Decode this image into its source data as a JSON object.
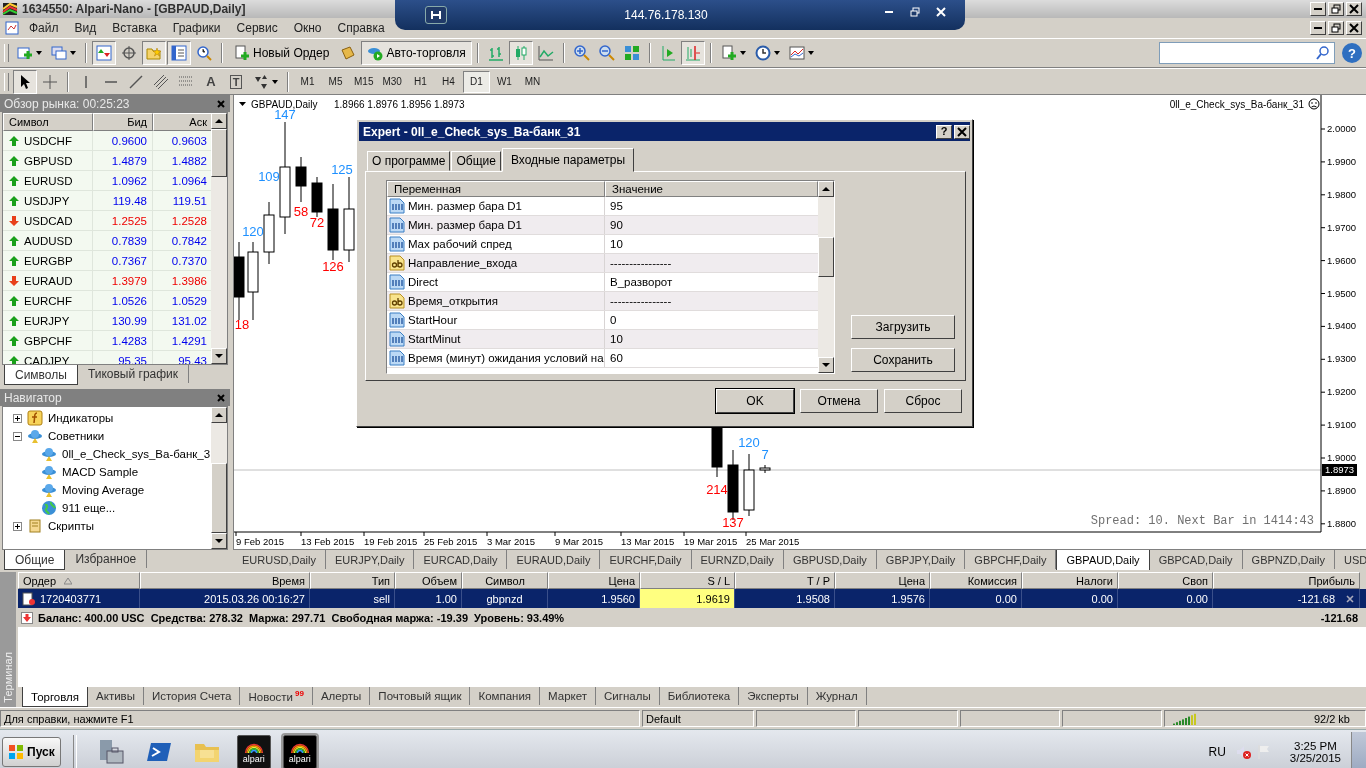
{
  "window": {
    "title": "1634550: Alpari-Nano - [GBPAUD,Daily]"
  },
  "remote_bar": {
    "address": "144.76.178.130"
  },
  "menu": [
    "Файл",
    "Вид",
    "Вставка",
    "Графики",
    "Сервис",
    "Окно",
    "Справка"
  ],
  "toolbar": {
    "new_order": "Новый Ордер",
    "autotrading": "Авто-торговля",
    "help_glyph": "?",
    "toggles": {
      "market_watch": true,
      "data_window": false,
      "navigator": true,
      "terminal": true,
      "tester": false,
      "autotrading": true,
      "bar_chart": false,
      "candlesticks": true,
      "line_chart": false,
      "autoscroll": false,
      "chart_shift": true,
      "cursor": true,
      "crosshair": false
    }
  },
  "drawing_tools": {
    "text_tool": "A",
    "label_tool": "T"
  },
  "timeframes": [
    {
      "label": "M1",
      "selected": false
    },
    {
      "label": "M5",
      "selected": false
    },
    {
      "label": "M15",
      "selected": false
    },
    {
      "label": "M30",
      "selected": false
    },
    {
      "label": "H1",
      "selected": false
    },
    {
      "label": "H4",
      "selected": false
    },
    {
      "label": "D1",
      "selected": true
    },
    {
      "label": "W1",
      "selected": false
    },
    {
      "label": "MN",
      "selected": false
    }
  ],
  "market_watch": {
    "title": "Обзор рынка: 00:25:23",
    "columns": [
      "Символ",
      "Бид",
      "Аск"
    ],
    "rows": [
      {
        "symbol": "USDCHF",
        "bid": "0.9600",
        "ask": "0.9603",
        "rising": true
      },
      {
        "symbol": "GBPUSD",
        "bid": "1.4879",
        "ask": "1.4882",
        "rising": true
      },
      {
        "symbol": "EURUSD",
        "bid": "1.0962",
        "ask": "1.0964",
        "rising": true
      },
      {
        "symbol": "USDJPY",
        "bid": "119.48",
        "ask": "119.51",
        "rising": true
      },
      {
        "symbol": "USDCAD",
        "bid": "1.2525",
        "ask": "1.2528",
        "rising": false
      },
      {
        "symbol": "AUDUSD",
        "bid": "0.7839",
        "ask": "0.7842",
        "rising": true
      },
      {
        "symbol": "EURGBP",
        "bid": "0.7367",
        "ask": "0.7370",
        "rising": true
      },
      {
        "symbol": "EURAUD",
        "bid": "1.3979",
        "ask": "1.3986",
        "rising": false
      },
      {
        "symbol": "EURCHF",
        "bid": "1.0526",
        "ask": "1.0529",
        "rising": true
      },
      {
        "symbol": "EURJPY",
        "bid": "130.99",
        "ask": "131.02",
        "rising": true
      },
      {
        "symbol": "GBPCHF",
        "bid": "1.4283",
        "ask": "1.4291",
        "rising": true
      },
      {
        "symbol": "CADJPY",
        "bid": "95.35",
        "ask": "95.43",
        "rising": true
      }
    ],
    "tabs": [
      {
        "label": "Символы",
        "selected": true
      },
      {
        "label": "Тиковый график",
        "selected": false
      }
    ]
  },
  "navigator": {
    "title": "Навигатор",
    "tree": [
      {
        "label": "Индикаторы",
        "kind": "indicators",
        "expanded": false
      },
      {
        "label": "Советники",
        "kind": "experts",
        "expanded": true,
        "children": [
          {
            "label": "0ll_e_Check_sys_Ва-банк_3",
            "kind": "expert"
          },
          {
            "label": "MACD Sample",
            "kind": "expert"
          },
          {
            "label": "Moving Average",
            "kind": "expert"
          },
          {
            "label": "911 еще...",
            "kind": "more"
          }
        ]
      },
      {
        "label": "Скрипты",
        "kind": "scripts",
        "expanded": false
      }
    ],
    "tabs": [
      {
        "label": "Общие",
        "selected": true
      },
      {
        "label": "Избранное",
        "selected": false
      }
    ]
  },
  "chart": {
    "symbol": "GBPAUD,Daily",
    "ohlc": "1.8966 1.8976 1.8956 1.8973",
    "expert_name": "0ll_e_Check_sys_Ва-банк_31",
    "price_ticks": [
      "2.0000",
      "1.9900",
      "1.9800",
      "1.9700",
      "1.9600",
      "1.9500",
      "1.9400",
      "1.9300",
      "1.9200",
      "1.9100",
      "1.9000",
      "1.8900",
      "1.8800"
    ],
    "current_price": "1.8973",
    "date_ticks": [
      "9 Feb 2015",
      "13 Feb 2015",
      "19 Feb 2015",
      "25 Feb 2015",
      "3 Mar 2015",
      "9 Mar 2015",
      "13 Mar 2015",
      "19 Mar 2015",
      "25 Mar 2015"
    ],
    "bar_labels": [
      {
        "text": "147",
        "color": "#1e90ff"
      },
      {
        "text": "109",
        "color": "#1e90ff"
      },
      {
        "text": "125",
        "color": "#1e90ff"
      },
      {
        "text": "120",
        "color": "#1e90ff"
      },
      {
        "text": "58",
        "color": "#ff0000"
      },
      {
        "text": "72",
        "color": "#ff0000"
      },
      {
        "text": "126",
        "color": "#ff0000"
      },
      {
        "text": "18",
        "color": "#ff0000"
      },
      {
        "text": "120",
        "color": "#1e90ff"
      },
      {
        "text": "7",
        "color": "#1e90ff"
      },
      {
        "text": "214",
        "color": "#ff0000"
      },
      {
        "text": "137",
        "color": "#ff0000"
      }
    ],
    "spread_info": "Spread: 10. Next Bar in 1414:43"
  },
  "chart_tabs": [
    {
      "label": "EURUSD,Daily",
      "selected": false
    },
    {
      "label": "EURJPY,Daily",
      "selected": false
    },
    {
      "label": "EURCAD,Daily",
      "selected": false
    },
    {
      "label": "EURAUD,Daily",
      "selected": false
    },
    {
      "label": "EURCHF,Daily",
      "selected": false
    },
    {
      "label": "EURNZD,Daily",
      "selected": false
    },
    {
      "label": "GBPUSD,Daily",
      "selected": false
    },
    {
      "label": "GBPJPY,Daily",
      "selected": false
    },
    {
      "label": "GBPCHF,Daily",
      "selected": false
    },
    {
      "label": "GBPAUD,Daily",
      "selected": true
    },
    {
      "label": "GBPCAD,Daily",
      "selected": false
    },
    {
      "label": "GBPNZD,Daily",
      "selected": false
    },
    {
      "label": "USD",
      "selected": false
    }
  ],
  "dialog": {
    "title": "Expert - 0ll_e_Check_sys_Ва-банк_31",
    "help_glyph": "?",
    "tabs": [
      {
        "label": "О программе",
        "selected": false
      },
      {
        "label": "Общие",
        "selected": false
      },
      {
        "label": "Входные параметры",
        "selected": true
      }
    ],
    "columns": [
      "Переменная",
      "Значение"
    ],
    "params": [
      {
        "name": "Мин. размер бара D1",
        "value": "95",
        "kind": "number"
      },
      {
        "name": "Мин. размер бара D1",
        "value": "90",
        "kind": "number"
      },
      {
        "name": "Max рабочий спред",
        "value": "10",
        "kind": "number"
      },
      {
        "name": "Направление_входа",
        "value": "----------------",
        "kind": "text"
      },
      {
        "name": "Direct",
        "value": "В_разворот",
        "kind": "number"
      },
      {
        "name": "Время_открытия",
        "value": "----------------",
        "kind": "text"
      },
      {
        "name": "StartHour",
        "value": "0",
        "kind": "number"
      },
      {
        "name": "StartMinut",
        "value": "10",
        "kind": "number"
      },
      {
        "name": "Время (минут) ожидания условий на",
        "value": "60",
        "kind": "number"
      }
    ],
    "side_buttons": [
      "Загрузить",
      "Сохранить"
    ],
    "buttons": [
      "OK",
      "Отмена",
      "Сброс"
    ]
  },
  "terminal": {
    "side_label": "Терминал",
    "columns": [
      "Ордер",
      "Время",
      "Тип",
      "Объем",
      "Символ",
      "Цена",
      "S / L",
      "T / P",
      "Цена",
      "Комиссия",
      "Налоги",
      "Своп",
      "Прибыль"
    ],
    "orders": [
      {
        "cells": [
          "1720403771",
          "2015.03.26 00:16:27",
          "sell",
          "1.00",
          "gbpnzd",
          "1.9560",
          "1.9619",
          "1.9508",
          "1.9576",
          "0.00",
          "0.00",
          "0.00",
          "-121.68"
        ],
        "selected": true,
        "sl_highlight": true
      }
    ],
    "balance": {
      "text": "Баланс: 400.00 USC  Средства: 278.32  Маржа: 297.71  Свободная маржа: -19.39  Уровень: 93.49%",
      "profit": "-121.68"
    },
    "tabs": [
      {
        "label": "Торговля",
        "selected": true
      },
      {
        "label": "Активы",
        "selected": false
      },
      {
        "label": "История Счета",
        "selected": false
      },
      {
        "label": "Новости",
        "badge": "99",
        "selected": false
      },
      {
        "label": "Алерты",
        "selected": false
      },
      {
        "label": "Почтовый ящик",
        "selected": false
      },
      {
        "label": "Компания",
        "selected": false
      },
      {
        "label": "Маркет",
        "selected": false
      },
      {
        "label": "Сигналы",
        "selected": false
      },
      {
        "label": "Библиотека",
        "selected": false
      },
      {
        "label": "Эксперты",
        "selected": false
      },
      {
        "label": "Журнал",
        "selected": false
      }
    ]
  },
  "status_bar": {
    "help": "Для справки, нажмите F1",
    "profile": "Default",
    "traffic": "92/2 kb"
  },
  "taskbar": {
    "start": "Пуск",
    "apps": [
      {
        "kind": "server"
      },
      {
        "kind": "powershell"
      },
      {
        "kind": "explorer"
      },
      {
        "kind": "alpari",
        "label": "alpari",
        "active": false
      },
      {
        "kind": "alpari",
        "label": "alpari",
        "active": true
      }
    ],
    "language": "RU",
    "time": "3:25 PM",
    "date": "3/25/2015"
  }
}
